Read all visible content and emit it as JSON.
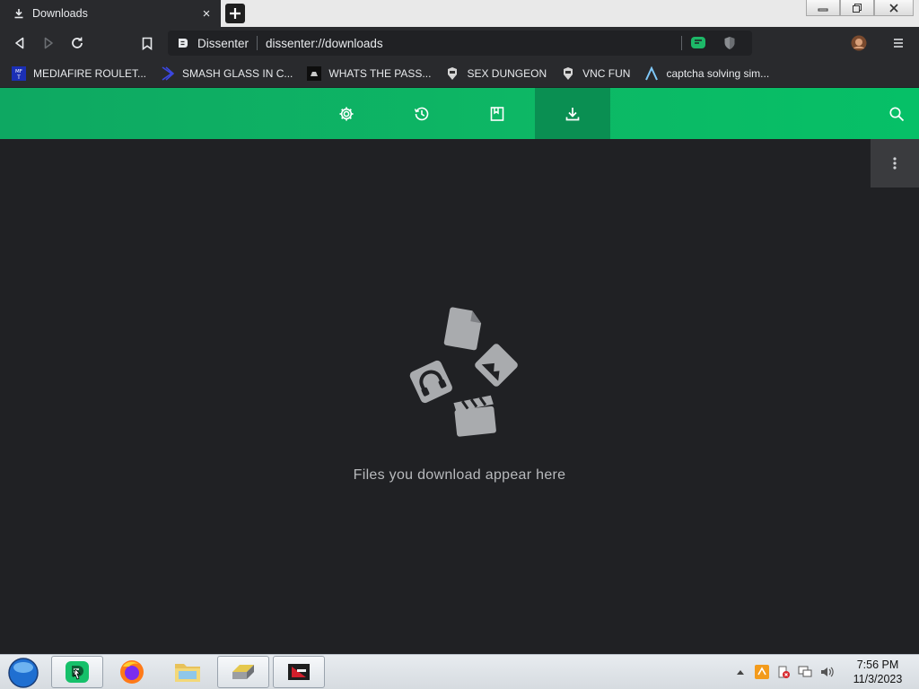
{
  "tab": {
    "title": "Downloads",
    "close": "×"
  },
  "window_controls": [
    "minimize",
    "restore",
    "close"
  ],
  "toolbar": {
    "site_name": "Dissenter",
    "url": "dissenter://downloads"
  },
  "bookmarks": [
    {
      "label": "MEDIAFIRE ROULET...",
      "icon": "mediafire-icon"
    },
    {
      "label": "SMASH GLASS IN C...",
      "icon": "chevron-bookmark-icon"
    },
    {
      "label": "WHATS THE PASS...",
      "icon": "box-bookmark-icon"
    },
    {
      "label": "SEX DUNGEON",
      "icon": "character-bookmark-icon"
    },
    {
      "label": "VNC FUN",
      "icon": "character-bookmark-icon"
    },
    {
      "label": "captcha solving sim...",
      "icon": "lambda-bookmark-icon"
    }
  ],
  "nav": {
    "items": [
      "settings",
      "history",
      "bookmarks",
      "downloads"
    ],
    "active": "downloads"
  },
  "main": {
    "empty_message": "Files you download appear here"
  },
  "taskbar": {
    "apps": [
      "dissenter",
      "firefox",
      "file-explorer",
      "drive-app",
      "video-app"
    ],
    "time": "7:56 PM",
    "date": "11/3/2023"
  },
  "colors": {
    "accent_green": "#0db865",
    "active_nav": "#0a8f52",
    "page_bg": "#202124",
    "chrome_bg": "#292a2d"
  }
}
